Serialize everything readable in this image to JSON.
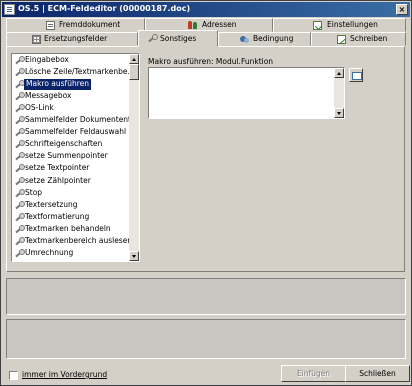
{
  "window": {
    "title": "OS.5 | ECM-Feldeditor (00000187.doc)",
    "close_glyph": "×"
  },
  "tabs_back_row": [
    {
      "label": "Fremddokument",
      "icon": "document-icon"
    },
    {
      "label": "Adressen",
      "icon": "people-icon"
    },
    {
      "label": "Einstellungen",
      "icon": "settings-icon"
    }
  ],
  "tabs_front_row": [
    {
      "label": "Ersetzungsfelder",
      "icon": "grid-icon"
    },
    {
      "label": "Sonstiges",
      "icon": "wrench-icon",
      "active": true
    },
    {
      "label": "Bedingung",
      "icon": "condition-icon"
    },
    {
      "label": "Schreiben",
      "icon": "write-icon"
    }
  ],
  "list": {
    "items": [
      "Eingabebox",
      "Lösche Zeile/Textmarkenbe...",
      "Makro ausführen",
      "Messagebox",
      "OS-Link",
      "Sammelfelder Dokumententyp",
      "Sammelfelder Feldauswahl",
      "Schrifteigenschaften",
      "setze Summenpointer",
      "setze Textpointer",
      "setze Zählpointer",
      "Stop",
      "Textersetzung",
      "Textformatierung",
      "Textmarken behandeln",
      "Textmarkenbereich auslesen",
      "Umrechnung"
    ],
    "selected_index": 2
  },
  "macro": {
    "label": "Makro ausführen: Modul.Funktion",
    "value": ""
  },
  "footer": {
    "always_on_top_label": "immer im Vordergrund",
    "always_on_top_checked": false,
    "insert_label": "Einfügen",
    "close_label": "Schließen"
  },
  "colors": {
    "face": "#d4d0c8",
    "title_start": "#0a246a",
    "title_end": "#3a6ea5",
    "selection": "#0a246a"
  }
}
